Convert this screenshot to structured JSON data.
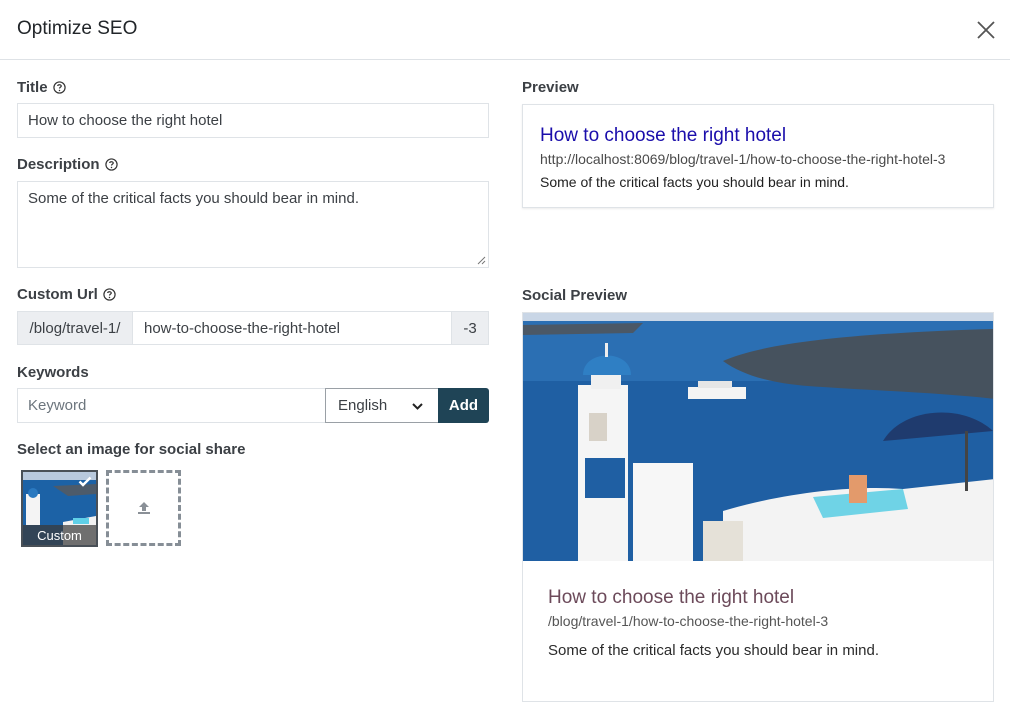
{
  "modal": {
    "title": "Optimize SEO"
  },
  "left": {
    "title_label": "Title",
    "title_value": "How to choose the right hotel",
    "description_label": "Description",
    "description_value": "Some of the critical facts you should bear in mind.",
    "custom_url_label": "Custom Url",
    "url_prefix": "/blog/travel-1/",
    "url_slug": "how-to-choose-the-right-hotel",
    "url_suffix": "-3",
    "keywords_label": "Keywords",
    "keyword_placeholder": "Keyword",
    "language_selected": "English",
    "add_label": "Add",
    "social_image_label": "Select an image for social share",
    "thumb_caption": "Custom"
  },
  "preview": {
    "label": "Preview",
    "title": "How to choose the right hotel",
    "url": "http://localhost:8069/blog/travel-1/how-to-choose-the-right-hotel-3",
    "description": "Some of the critical facts you should bear in mind."
  },
  "social_preview": {
    "label": "Social Preview",
    "title": "How to choose the right hotel",
    "url": "/blog/travel-1/how-to-choose-the-right-hotel-3",
    "description": "Some of the critical facts you should bear in mind."
  },
  "colors": {
    "primary": "#1f4456",
    "preview_link": "#1a0dab",
    "social_title": "#6c4a5a"
  }
}
